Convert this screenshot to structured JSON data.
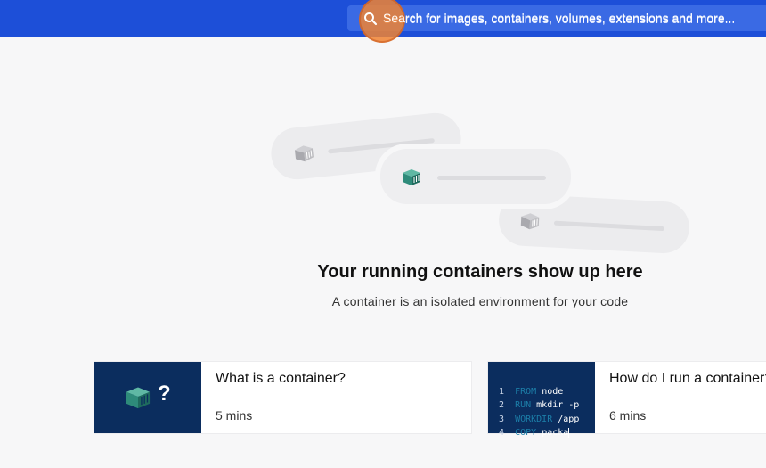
{
  "search": {
    "placeholder": "Search for images, containers, volumes, extensions and more..."
  },
  "empty_state": {
    "title": "Your running containers show up here",
    "subtitle": "A container is an isolated environment for your code"
  },
  "cards": [
    {
      "title": "What is a container?",
      "duration": "5 mins",
      "thumb_symbol": "?"
    },
    {
      "title": "How do I run a container?",
      "duration": "6 mins",
      "code": [
        {
          "n": "1",
          "kw": "FROM",
          "rest": " node"
        },
        {
          "n": "2",
          "kw": "RUN",
          "rest": " mkdir -p"
        },
        {
          "n": "3",
          "kw": "WORKDIR",
          "rest": " /app"
        },
        {
          "n": "4",
          "kw": "COPY",
          "rest": " packa"
        }
      ]
    }
  ],
  "colors": {
    "topbar": "#1d4fd8",
    "accent_container": "#2e8b7a",
    "grey_container": "#b8b8bc"
  },
  "icons": [
    "search-icon",
    "container-icon",
    "question-mark-icon"
  ]
}
